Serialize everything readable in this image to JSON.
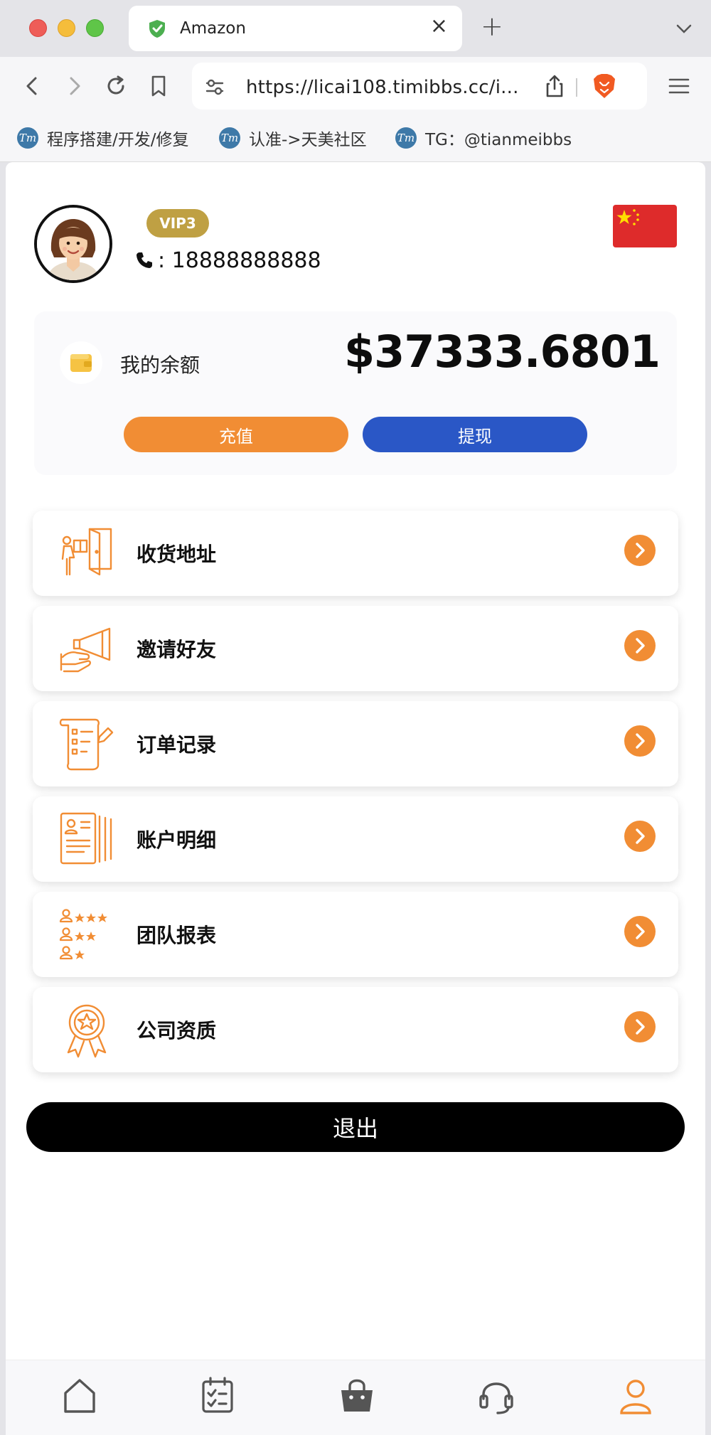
{
  "browser": {
    "tab_title": "Amazon",
    "url": "https://licai108.timibbs.cc/i...",
    "bookmarks": [
      "程序搭建/开发/修复",
      "认准->天美社区",
      "TG：@tianmeibbs"
    ],
    "bookmark_logo": "Tm"
  },
  "profile": {
    "vip_level": "VIP3",
    "phone": ": 18888888888"
  },
  "balance": {
    "label": "我的余额",
    "amount": "$37333.6801",
    "recharge_label": "充值",
    "withdraw_label": "提现"
  },
  "menu": {
    "items": [
      {
        "label": "收货地址",
        "icon": "delivery-address-icon"
      },
      {
        "label": "邀请好友",
        "icon": "megaphone-invite-icon"
      },
      {
        "label": "订单记录",
        "icon": "order-list-icon"
      },
      {
        "label": "账户明细",
        "icon": "account-details-icon"
      },
      {
        "label": "团队报表",
        "icon": "team-rating-icon"
      },
      {
        "label": "公司资质",
        "icon": "award-badge-icon"
      }
    ]
  },
  "logout_label": "退出",
  "bottom_nav": [
    "home-icon",
    "tasks-icon",
    "shop-bag-icon",
    "support-headset-icon",
    "profile-icon"
  ],
  "colors": {
    "accent_orange": "#f18d34",
    "withdraw_blue": "#2a57c6",
    "vip_gold": "#bfa043",
    "flag_red": "#de2b2b"
  }
}
